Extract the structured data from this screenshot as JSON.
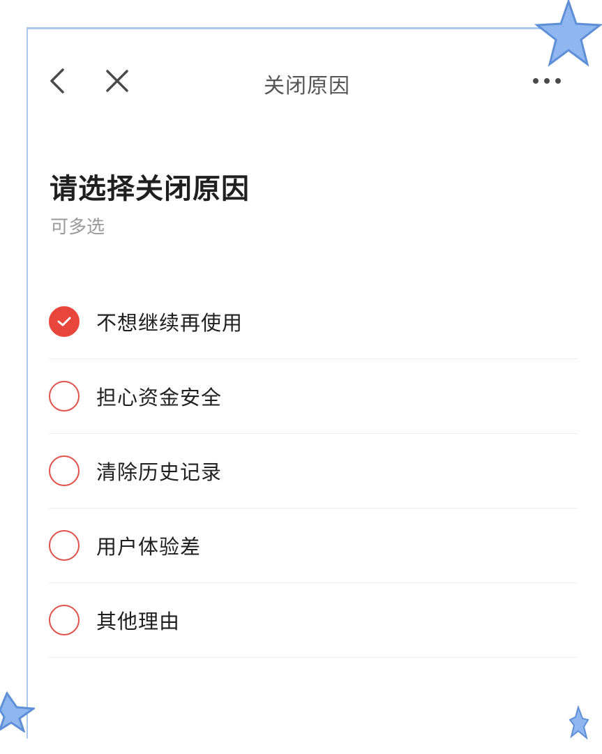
{
  "header": {
    "title": "关闭原因"
  },
  "icons": {
    "back": "chevron-left-icon",
    "close": "close-icon",
    "more": "more-horizontal-icon",
    "checked": "check-icon"
  },
  "main": {
    "heading": "请选择关闭原因",
    "subtitle": "可多选",
    "options": [
      {
        "label": "不想继续再使用",
        "checked": true
      },
      {
        "label": "担心资金安全",
        "checked": false
      },
      {
        "label": "清除历史记录",
        "checked": false
      },
      {
        "label": "用户体验差",
        "checked": false
      },
      {
        "label": "其他理由",
        "checked": false
      }
    ]
  },
  "colors": {
    "accent": "#e8453c",
    "frame": "#a9c8ef",
    "text": "#1f1f1f",
    "muted": "#9a9a9a"
  }
}
